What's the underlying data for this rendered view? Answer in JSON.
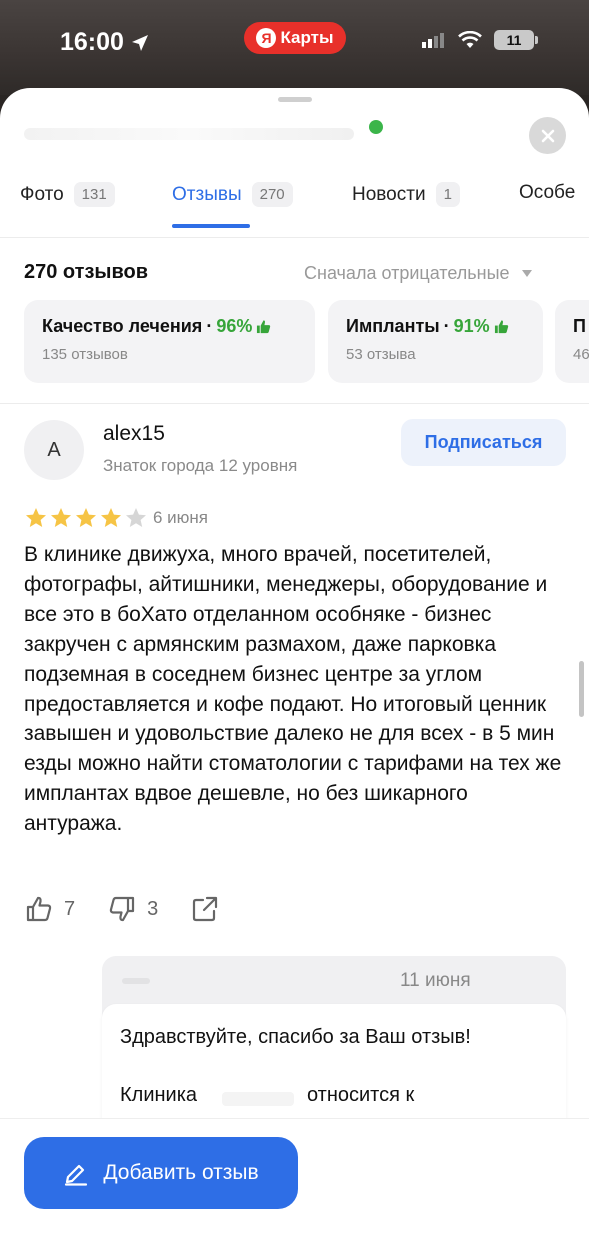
{
  "status_bar": {
    "time": "16:00",
    "app_pill": "Карты",
    "app_pill_logo": "Я",
    "battery": "11"
  },
  "tabs": [
    {
      "label": "Фото",
      "count": "131"
    },
    {
      "label": "Отзывы",
      "count": "270"
    },
    {
      "label": "Новости",
      "count": "1"
    },
    {
      "label": "Особе"
    }
  ],
  "summary": {
    "total": "270 отзывов",
    "sort": "Сначала отрицательные"
  },
  "categories": [
    {
      "name": "Качество лечения",
      "sep": "·",
      "percent": "96%",
      "sub": "135 отзывов"
    },
    {
      "name": "Импланты",
      "sep": "·",
      "percent": "91%",
      "sub": "53 отзыва"
    },
    {
      "name": "П",
      "sub": "46"
    }
  ],
  "review": {
    "avatar_letter": "A",
    "author": "alex15",
    "level": "Знаток города 12 уровня",
    "subscribe": "Подписаться",
    "rating": 4,
    "rating_max": 5,
    "date": "6 июня",
    "text": "В клинике движуха, много врачей, посетителей, фотографы, айтишники, менеджеры, оборудование и все это в боХато отделанном особняке - бизнес закручен с армянским размахом, даже парковка подземная в соседнем бизнес центре за углом предоставляется и кофе подают. Но итоговый ценник завышен и удовольствие далеко не для всех - в 5 мин езды можно найти стоматологии с тарифами на тех же имплантах вдвое дешевле, но без шикарного антуража.",
    "likes": "7",
    "dislikes": "3"
  },
  "reply": {
    "date": "11 июня",
    "line1": "Здравствуйте, спасибо за Ваш отзыв!",
    "line2_start": "Клиника",
    "line2_end": "относится к"
  },
  "bottom": {
    "add_review": "Добавить отзыв"
  },
  "colors": {
    "accent": "#2e6ee6",
    "positive": "#37a53a",
    "star": "#f6c445",
    "star_empty": "#d6d6d6",
    "maps_red": "#e8302a"
  }
}
